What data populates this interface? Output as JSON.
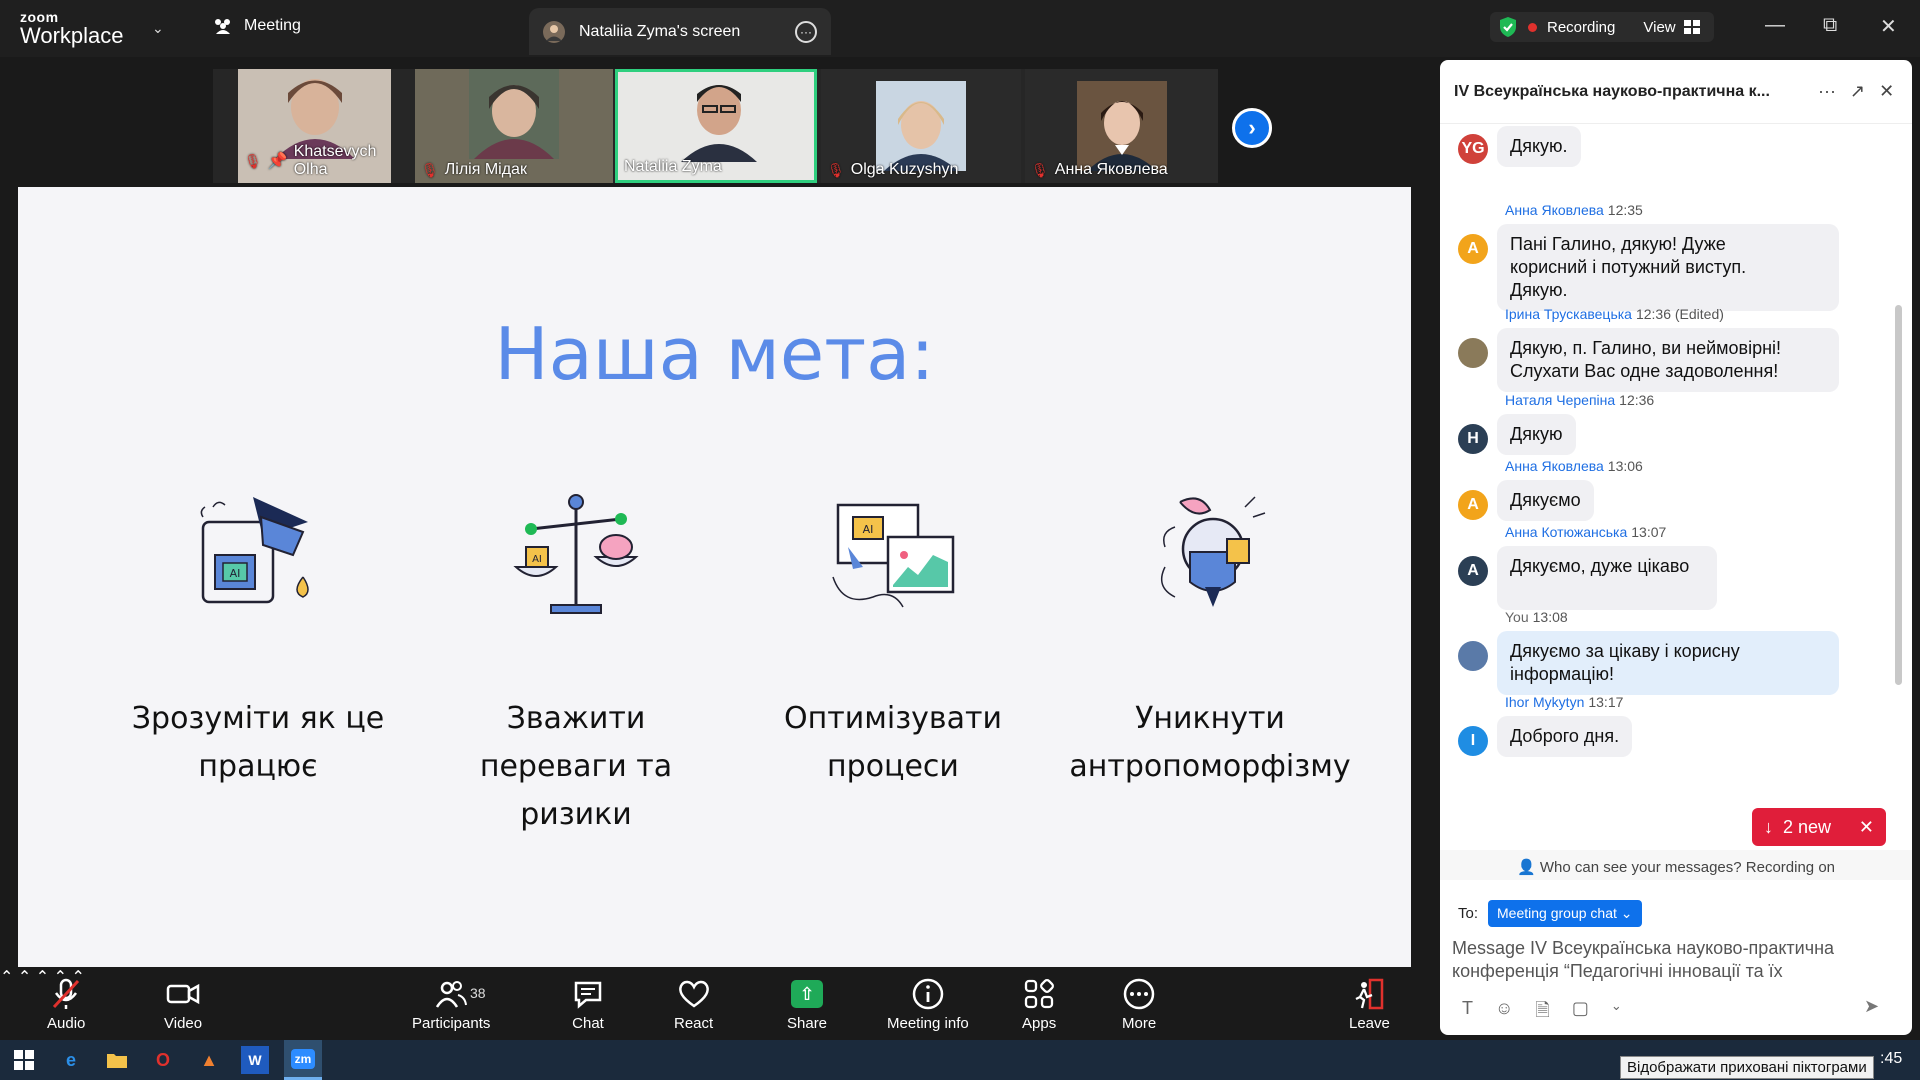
{
  "app": {
    "logo_line1": "zoom",
    "logo_line2": "Workplace"
  },
  "titlebar": {
    "meeting_tab": "Meeting",
    "screen_tab": "Nataliia Zyma's screen",
    "recording": "Recording",
    "view": "View"
  },
  "thumbnails": [
    {
      "name": "Khatsevych Olha",
      "muted": true,
      "pinned": true
    },
    {
      "name": "Лілія Мідак",
      "muted": true
    },
    {
      "name": "Nataliia Zyma",
      "muted": false,
      "active": true
    },
    {
      "name": "Olga Kuzyshyn",
      "muted": true
    },
    {
      "name": "Анна Яковлева",
      "muted": true
    }
  ],
  "slide": {
    "title": "Наша мета:",
    "goals": [
      {
        "line1": "Зрозуміти як це",
        "line2": "працює",
        "line3": ""
      },
      {
        "line1": "Зважити",
        "line2": "переваги та",
        "line3": "ризики"
      },
      {
        "line1": "Оптимізувати",
        "line2": "процеси",
        "line3": ""
      },
      {
        "line1": "Уникнути",
        "line2": "антропоморфізму",
        "line3": ""
      }
    ]
  },
  "toolbar": {
    "audio": "Audio",
    "video": "Video",
    "participants": "Participants",
    "participants_count": "38",
    "chat": "Chat",
    "react": "React",
    "share": "Share",
    "meeting_info": "Meeting info",
    "apps": "Apps",
    "more": "More",
    "leave": "Leave"
  },
  "chat": {
    "title": "IV Всеукраїнська науково-практична к...",
    "messages": [
      {
        "avatar": "YG",
        "color": "#d0413a",
        "sender": "",
        "time": "",
        "lines": [
          "Дякую."
        ]
      },
      {
        "avatar": "A",
        "color": "#f2a41b",
        "sender": "Анна Яковлева",
        "time": "12:35",
        "lines": [
          "Пані Галино, дякую!  Дуже",
          "корисний і потужний виступ.",
          "Дякую."
        ]
      },
      {
        "avatar": "",
        "color": "#8a7a5a",
        "sender": "Ірина Трускавецька",
        "time": "12:36 (Edited)",
        "lines": [
          "Дякую, п. Галино, ви неймовірні!",
          "Слухати Вас одне задоволення!"
        ]
      },
      {
        "avatar": "Н",
        "color": "#2b3f55",
        "sender": "Наталя Черепіна",
        "time": "12:36",
        "lines": [
          "Дякую"
        ]
      },
      {
        "avatar": "A",
        "color": "#f2a41b",
        "sender": "Анна Яковлева",
        "time": "13:06",
        "lines": [
          "Дякуємо"
        ]
      },
      {
        "avatar": "A",
        "color": "#2b3f55",
        "sender": "Анна Котюжанська",
        "time": "13:07",
        "lines": [
          "Дякуємо, дуже цікаво",
          " "
        ]
      },
      {
        "avatar": "",
        "color": "#5a7aa8",
        "sender": "You",
        "time": "13:08",
        "lines": [
          "Дякуємо за цікаву і корисну",
          "інформацію!"
        ],
        "me": true
      },
      {
        "avatar": "I",
        "color": "#1f8de3",
        "sender": "Ihor Mykytyn",
        "time": "13:17",
        "lines": [
          "Доброго дня."
        ]
      }
    ],
    "new_badge": "2 new",
    "who_can_see": "Who can see your messages? Recording on",
    "to_label": "To:",
    "to_chip": "Meeting group chat",
    "input_line1": "Message IV Всеукраїнська науково-практична",
    "input_line2": "конференція “Педагогічні інновації та їх"
  },
  "taskbar": {
    "tooltip": "Відображати приховані піктограми",
    "clock": ":45"
  }
}
